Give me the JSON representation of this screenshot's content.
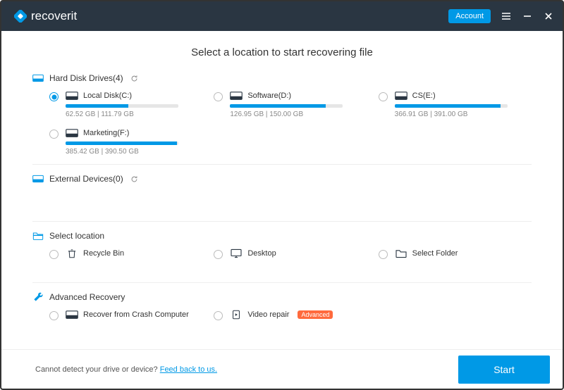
{
  "brand": "recoverit",
  "account_label": "Account",
  "title": "Select a location to start recovering file",
  "sections": {
    "hdd": {
      "label": "Hard Disk Drives(4)"
    },
    "external": {
      "label": "External Devices(0)"
    },
    "select_loc": {
      "label": "Select location"
    },
    "advanced": {
      "label": "Advanced Recovery"
    }
  },
  "drives": [
    {
      "label": "Local Disk(C:)",
      "used": 62.52,
      "total": 111.79,
      "size_text": "62.52  GB | 111.79  GB",
      "selected": true
    },
    {
      "label": "Software(D:)",
      "used": 126.95,
      "total": 150.0,
      "size_text": "126.95  GB | 150.00  GB",
      "selected": false
    },
    {
      "label": "CS(E:)",
      "used": 366.91,
      "total": 391.0,
      "size_text": "366.91  GB | 391.00  GB",
      "selected": false
    },
    {
      "label": "Marketing(F:)",
      "used": 385.42,
      "total": 390.5,
      "size_text": "385.42  GB | 390.50  GB",
      "selected": false
    }
  ],
  "locations": [
    {
      "label": "Recycle Bin"
    },
    {
      "label": "Desktop"
    },
    {
      "label": "Select Folder"
    }
  ],
  "advanced_items": [
    {
      "label": "Recover from Crash Computer",
      "badge": null
    },
    {
      "label": "Video repair",
      "badge": "Advanced"
    }
  ],
  "footer": {
    "prompt": "Cannot detect your drive or device? ",
    "link": "Feed back to us."
  },
  "start_label": "Start"
}
